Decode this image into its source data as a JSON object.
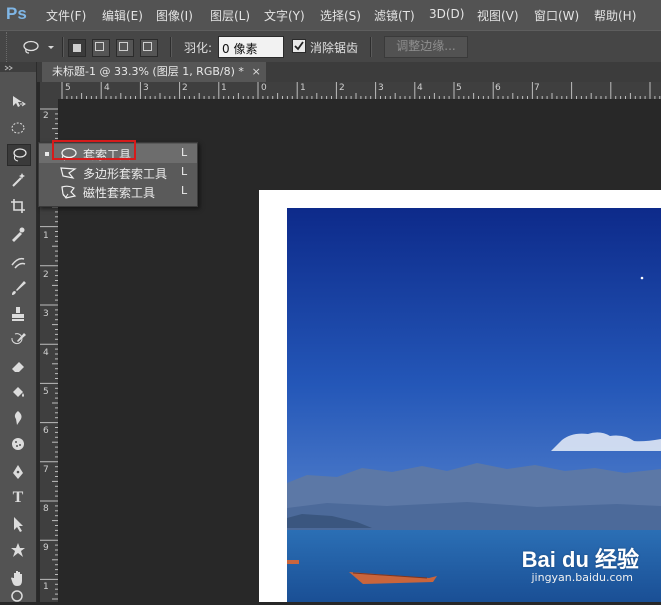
{
  "app": {
    "logo": "Ps"
  },
  "menu": [
    "文件(F)",
    "编辑(E)",
    "图像(I)",
    "图层(L)",
    "文字(Y)",
    "选择(S)",
    "滤镜(T)",
    "3D(D)",
    "视图(V)",
    "窗口(W)",
    "帮助(H)"
  ],
  "options": {
    "feather_label": "羽化:",
    "feather_value": "0 像素",
    "antialias_label": "消除锯齿",
    "antialias_checked": true,
    "refine_edge_button": "调整边缘..."
  },
  "document_tab": {
    "title": "未标题-1 @ 33.3% (图层 1, RGB/8) *",
    "close": "×"
  },
  "ruler_top": [
    "5",
    "4",
    "3",
    "2",
    "1",
    "0",
    "1",
    "2",
    "3",
    "4",
    "5",
    "6",
    "7"
  ],
  "ruler_left": [
    "2",
    "1",
    "0",
    "1",
    "2",
    "3",
    "4",
    "5",
    "6",
    "7",
    "8",
    "9",
    "1"
  ],
  "flyout": {
    "items": [
      {
        "label": "套索工具",
        "key": "L",
        "icon": "lasso-icon",
        "selected": true
      },
      {
        "label": "多边形套索工具",
        "key": "L",
        "icon": "polygonal-lasso-icon",
        "selected": false
      },
      {
        "label": "磁性套索工具",
        "key": "L",
        "icon": "magnetic-lasso-icon",
        "selected": false
      }
    ]
  },
  "tools": [
    "move-tool",
    "marquee-tool",
    "lasso-tool",
    "magic-wand-tool",
    "crop-tool",
    "eyedropper-tool",
    "healing-tool",
    "brush-tool",
    "stamp-tool",
    "history-brush-tool",
    "eraser-tool",
    "gradient-tool",
    "blur-tool",
    "dodge-tool",
    "pen-tool",
    "type-tool",
    "path-select-tool",
    "shape-tool",
    "hand-tool"
  ],
  "type_tool_glyph": "T",
  "watermark": {
    "brand": "Bai du 经验",
    "url": "jingyan.baidu.com"
  },
  "colors": {
    "menubar": "#535353",
    "optbar": "#464646",
    "highlight": "#d61b1b",
    "sky_top": "#0d2a8a",
    "sky_bottom": "#5f8fd6"
  }
}
